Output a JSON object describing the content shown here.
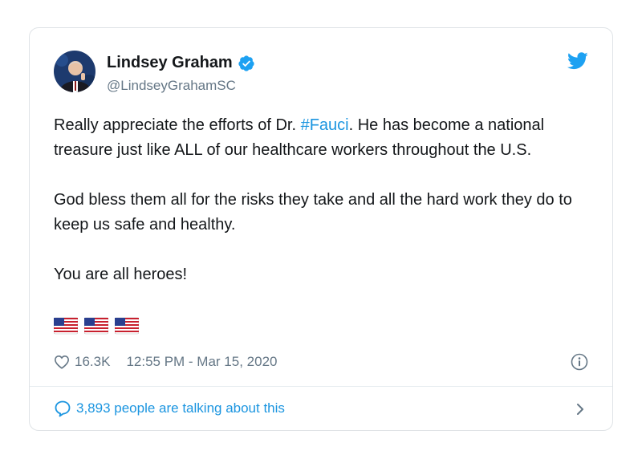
{
  "tweet": {
    "author_name": "Lindsey Graham",
    "author_handle": "@LindseyGrahamSC",
    "text_p1_before": "Really appreciate the efforts of Dr. ",
    "hashtag": "#Fauci",
    "text_p1_after": ". He has become a national treasure just like ALL of our healthcare workers throughout the U.S.",
    "text_p2": "God bless them all for the risks they take and all the hard work they do to keep us safe and healthy.",
    "text_p3": "You are all heroes!",
    "flags": [
      "us-flag-emoji",
      "us-flag-emoji",
      "us-flag-emoji"
    ],
    "likes": "16.3K",
    "timestamp": "12:55 PM - Mar 15, 2020",
    "talking": "3,893 people are talking about this"
  },
  "colors": {
    "accent": "#1b95e0",
    "twitter_blue": "#1da1f2",
    "secondary_text": "#657786",
    "primary_text": "#14171a",
    "border": "#dfe3e6"
  }
}
